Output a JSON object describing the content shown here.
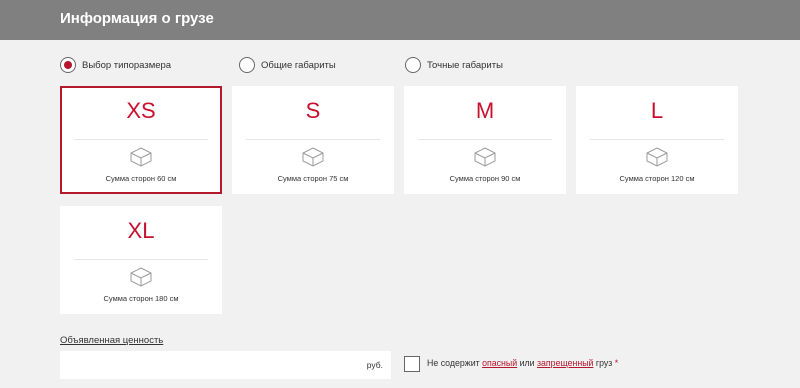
{
  "header": {
    "title": "Информация о грузе"
  },
  "radios": [
    {
      "label": "Выбор типоразмера",
      "selected": true
    },
    {
      "label": "Общие габариты",
      "selected": false
    },
    {
      "label": "Точные габариты",
      "selected": false
    }
  ],
  "cards": [
    {
      "size": "XS",
      "desc": "Сумма сторон 60 см",
      "selected": true
    },
    {
      "size": "S",
      "desc": "Сумма сторон 75 см",
      "selected": false
    },
    {
      "size": "M",
      "desc": "Сумма сторон 90 см",
      "selected": false
    },
    {
      "size": "L",
      "desc": "Сумма сторон 120 см",
      "selected": false
    },
    {
      "size": "XL",
      "desc": "Сумма сторон 180 см",
      "selected": false
    }
  ],
  "card_icon": "box-icon",
  "declared_value": {
    "label": "Объявленная ценность",
    "value": "",
    "currency": "руб."
  },
  "cargo_check": {
    "text_before": "Не содержит ",
    "link_dangerous": "опасный",
    "text_or": " или ",
    "link_forbidden": "запрещенный",
    "text_after": " груз ",
    "required_mark": "*",
    "checked": false
  },
  "colors": {
    "accent": "#c8102e",
    "header_bg": "#808080",
    "page_bg": "#f1f1f1"
  }
}
